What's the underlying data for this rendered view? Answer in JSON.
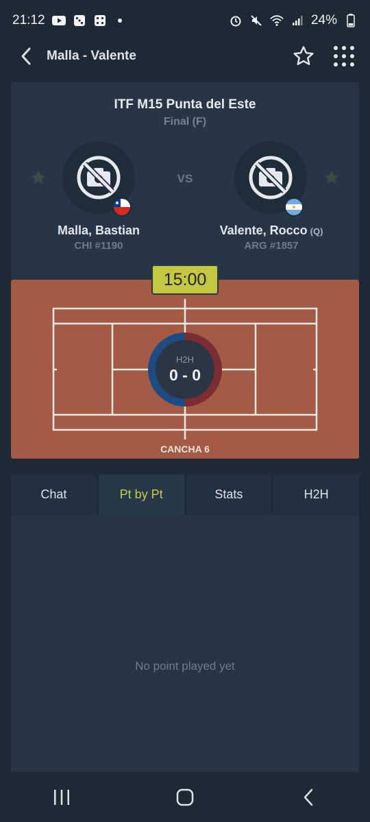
{
  "status": {
    "time": "21:12",
    "battery": "24%",
    "icons": [
      "youtube-icon",
      "dice-icon",
      "dice-icon",
      "alarm-icon",
      "mute-icon",
      "wifi-icon",
      "signal-icon",
      "battery-icon"
    ]
  },
  "appbar": {
    "title": "Malla - Valente",
    "back_icon": "chevron-left-icon",
    "favorite_icon": "star-outline-icon",
    "menu_icon": "grid-dots-icon"
  },
  "match": {
    "tournament": "ITF M15 Punta del Este",
    "round": "Final (F)",
    "vs_label": "VS",
    "player1": {
      "name": "Malla, Bastian",
      "rank": "CHI #1190",
      "flag": "chile-flag"
    },
    "player2": {
      "name": "Valente, Rocco",
      "qualifier": "(Q)",
      "rank": "ARG #1857",
      "flag": "argentina-flag"
    }
  },
  "court": {
    "time": "15:00",
    "h2h_label": "H2H",
    "h2h_score": "0 - 0",
    "name": "CANCHA 6"
  },
  "tabs": [
    {
      "label": "Chat",
      "active": false
    },
    {
      "label": "Pt by Pt",
      "active": true
    },
    {
      "label": "Stats",
      "active": false
    },
    {
      "label": "H2H",
      "active": false
    }
  ],
  "content": {
    "empty_message": "No point played yet"
  },
  "colors": {
    "background": "#1d2a36",
    "card": "#263646",
    "accent_yellow": "#c7cb45",
    "clay": "#a45a44",
    "h2h_red": "#7b2d33",
    "h2h_blue": "#1c4c82"
  }
}
